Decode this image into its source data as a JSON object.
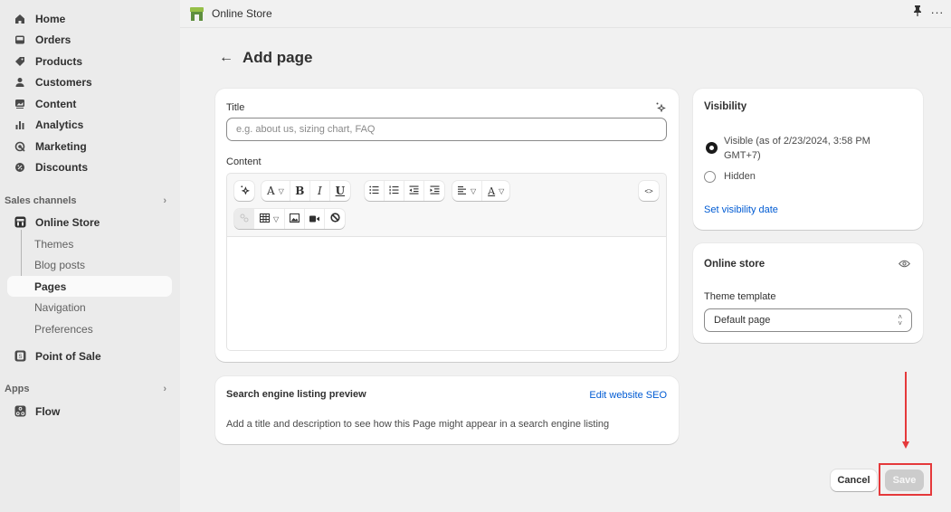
{
  "app": {
    "name": "Online Store",
    "brand_color": "#5e8e3e"
  },
  "sidebar": {
    "items": [
      {
        "label": "Home",
        "icon": "home-icon"
      },
      {
        "label": "Orders",
        "icon": "inbox-icon"
      },
      {
        "label": "Products",
        "icon": "tag-icon"
      },
      {
        "label": "Customers",
        "icon": "person-icon"
      },
      {
        "label": "Content",
        "icon": "image-icon"
      },
      {
        "label": "Analytics",
        "icon": "bar-chart-icon"
      },
      {
        "label": "Marketing",
        "icon": "target-icon"
      },
      {
        "label": "Discounts",
        "icon": "discount-icon"
      }
    ],
    "sales_channels": {
      "header": "Sales channels",
      "online_store": "Online Store",
      "sub_items": [
        "Themes",
        "Blog posts",
        "Pages",
        "Navigation",
        "Preferences"
      ],
      "active_sub_item": "Pages",
      "point_of_sale": "Point of Sale"
    },
    "apps": {
      "header": "Apps",
      "items": [
        "Flow"
      ]
    }
  },
  "page": {
    "title": "Add page"
  },
  "main_card": {
    "title_label": "Title",
    "title_placeholder": "e.g. about us, sizing chart, FAQ",
    "title_value": "",
    "content_label": "Content",
    "toolbar": {
      "font_letter": "A",
      "bold": "B",
      "italic": "I",
      "underline": "U",
      "text_color_letter": "A",
      "code_view": "<>"
    }
  },
  "seo_card": {
    "title": "Search engine listing preview",
    "edit_link": "Edit website SEO",
    "description": "Add a title and description to see how this Page might appear in a search engine listing"
  },
  "visibility_card": {
    "title": "Visibility",
    "options": [
      {
        "label": "Visible (as of 2/23/2024, 3:58 PM GMT+7)",
        "checked": true
      },
      {
        "label": "Hidden",
        "checked": false
      }
    ],
    "set_date_link": "Set visibility date"
  },
  "online_store_card": {
    "title": "Online store",
    "template_label": "Theme template",
    "template_value": "Default page"
  },
  "actions": {
    "cancel": "Cancel",
    "save": "Save",
    "save_disabled": true
  },
  "annotation": {
    "color": "#e5393b",
    "target": "Save"
  }
}
